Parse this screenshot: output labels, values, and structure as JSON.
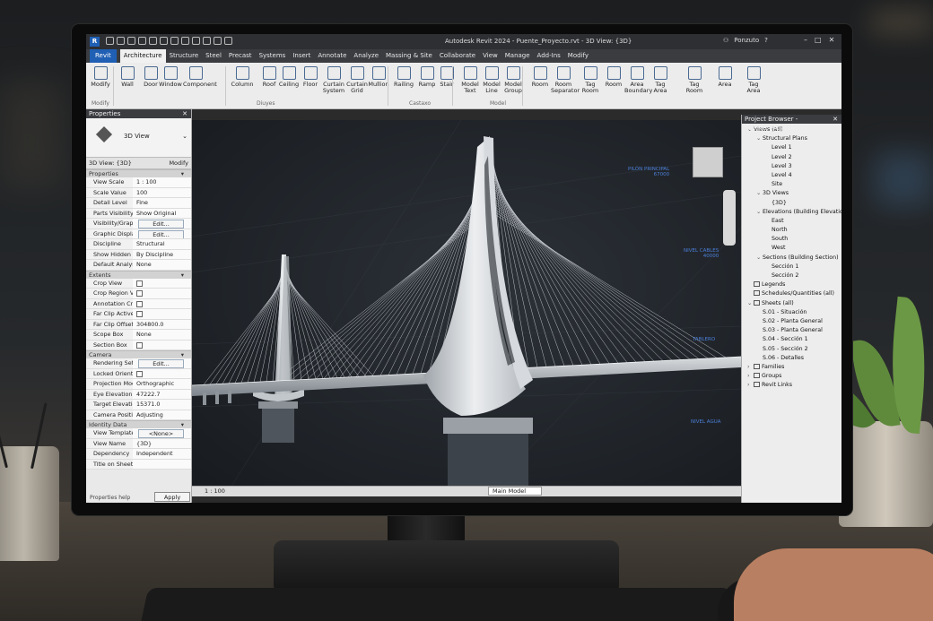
{
  "app": {
    "title": "Autodesk Revit 2024 - Puente_Proyecto.rvt - 3D View: {3D}",
    "logo": "R",
    "user": "Ponzuto"
  },
  "tabs": [
    {
      "label": "Revit",
      "file": true
    },
    {
      "label": "Architecture",
      "active": true
    },
    {
      "label": "Structure"
    },
    {
      "label": "Steel"
    },
    {
      "label": "Precast"
    },
    {
      "label": "Systems"
    },
    {
      "label": "Insert"
    },
    {
      "label": "Annotate"
    },
    {
      "label": "Analyze"
    },
    {
      "label": "Massing & Site"
    },
    {
      "label": "Collaborate"
    },
    {
      "label": "View"
    },
    {
      "label": "Manage"
    },
    {
      "label": "Add-Ins"
    },
    {
      "label": "Modify"
    }
  ],
  "ribbon": {
    "buttons": [
      "Modify",
      "Wall",
      "Door",
      "Window",
      "Component",
      "Column",
      "Roof",
      "Ceiling",
      "Floor",
      "Curtain System",
      "Curtain Grid",
      "Mullion",
      "Railing",
      "Ramp",
      "Stair",
      "Model Text",
      "Model Line",
      "Model Group",
      "Room",
      "Room Separator",
      "Tag Room",
      "Room",
      "Area Boundary",
      "Tag Area",
      "Tag Room",
      "Area",
      "Tag Area"
    ],
    "groups": [
      "Modify",
      "Diuyes",
      "Castaxo",
      "Model"
    ]
  },
  "properties": {
    "panel_title": "Properties",
    "type_name": "3D View",
    "instance": "3D View: {3D}",
    "edit_type": "Modify",
    "sections": [
      {
        "title": "Properties",
        "rows": [
          {
            "k": "View Scale",
            "v": "1 : 100"
          },
          {
            "k": "Scale Value",
            "v": "100"
          },
          {
            "k": "Detail Level",
            "v": "Fine"
          },
          {
            "k": "Parts Visibility",
            "v": "Show Original"
          },
          {
            "k": "Visibility/Graphi...",
            "v": "Edit...",
            "btn": true
          },
          {
            "k": "Graphic Display...",
            "v": "Edit...",
            "btn": true
          },
          {
            "k": "Discipline",
            "v": "Structural"
          },
          {
            "k": "Show Hidden Li...",
            "v": "By Discipline"
          },
          {
            "k": "Default Analysis...",
            "v": "None"
          }
        ]
      },
      {
        "title": "Extents",
        "rows": [
          {
            "k": "Crop View",
            "cb": true
          },
          {
            "k": "Crop Region Vis...",
            "cb": true
          },
          {
            "k": "Annotation Crop",
            "cb": true
          },
          {
            "k": "Far Clip Active",
            "cb": true
          },
          {
            "k": "Far Clip Offset",
            "v": "304800.0"
          },
          {
            "k": "Scope Box",
            "v": "None"
          },
          {
            "k": "Section Box",
            "cb": true
          }
        ]
      },
      {
        "title": "Camera",
        "rows": [
          {
            "k": "Rendering Setti...",
            "v": "Edit...",
            "btn": true
          },
          {
            "k": "Locked Orientat...",
            "cb": true
          },
          {
            "k": "Projection Mode",
            "v": "Orthographic"
          },
          {
            "k": "Eye Elevation",
            "v": "47222.7"
          },
          {
            "k": "Target Elevation",
            "v": "15371.0"
          },
          {
            "k": "Camera Position",
            "v": "Adjusting"
          }
        ]
      },
      {
        "title": "Identity Data",
        "rows": [
          {
            "k": "View Template",
            "v": "<None>",
            "btn": true
          },
          {
            "k": "View Name",
            "v": "{3D}"
          },
          {
            "k": "Dependency",
            "v": "Independent"
          },
          {
            "k": "Title on Sheet",
            "v": ""
          }
        ]
      }
    ],
    "help": "Properties help",
    "apply": "Apply"
  },
  "viewport": {
    "labels": [
      {
        "text": "PILÓN PRINCIPAL\n67000"
      },
      {
        "text": "NIVEL CABLES\n40000"
      },
      {
        "text": "TABLERO"
      },
      {
        "text": "NIVEL AGUA"
      }
    ]
  },
  "status": {
    "scale": "1 : 100",
    "model": "Main Model"
  },
  "browser": {
    "title": "Project Browser - Puente_Proyecto.rvt",
    "nodes": [
      {
        "label": "Views (all)",
        "depth": 0,
        "tg": "−"
      },
      {
        "label": "Structural Plans",
        "depth": 1,
        "tg": "−"
      },
      {
        "label": "Level 1",
        "depth": 2
      },
      {
        "label": "Level 2",
        "depth": 2
      },
      {
        "label": "Level 3",
        "depth": 2
      },
      {
        "label": "Level 4",
        "depth": 2
      },
      {
        "label": "Site",
        "depth": 2
      },
      {
        "label": "3D Views",
        "depth": 1,
        "tg": "−"
      },
      {
        "label": "{3D}",
        "depth": 2
      },
      {
        "label": "Elevations (Building Elevation)",
        "depth": 1,
        "tg": "−"
      },
      {
        "label": "East",
        "depth": 2
      },
      {
        "label": "North",
        "depth": 2
      },
      {
        "label": "South",
        "depth": 2
      },
      {
        "label": "West",
        "depth": 2
      },
      {
        "label": "Sections (Building Section)",
        "depth": 1,
        "tg": "−"
      },
      {
        "label": "Sección 1",
        "depth": 2
      },
      {
        "label": "Sección 2",
        "depth": 2
      },
      {
        "label": "Legends",
        "depth": 0,
        "fi": true
      },
      {
        "label": "Schedules/Quantities (all)",
        "depth": 0,
        "fi": true
      },
      {
        "label": "Sheets (all)",
        "depth": 0,
        "tg": "−",
        "fi": true
      },
      {
        "label": "S.01 - Situación",
        "depth": 1
      },
      {
        "label": "S.02 - Planta General",
        "depth": 1
      },
      {
        "label": "S.03 - Planta General",
        "depth": 1
      },
      {
        "label": "S.04 - Sección 1",
        "depth": 1
      },
      {
        "label": "S.05 - Sección 2",
        "depth": 1
      },
      {
        "label": "S.06 - Detalles",
        "depth": 1
      },
      {
        "label": "Families",
        "depth": 0,
        "tg": "+",
        "fi": true
      },
      {
        "label": "Groups",
        "depth": 0,
        "tg": "+",
        "fi": true
      },
      {
        "label": "Revit Links",
        "depth": 0,
        "tg": "+",
        "fi": true
      }
    ]
  }
}
